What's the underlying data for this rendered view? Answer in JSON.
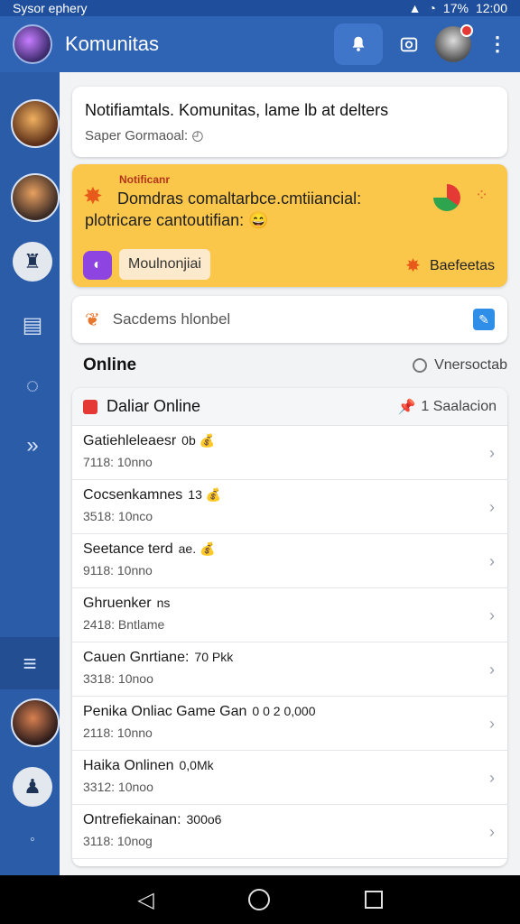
{
  "status_bar": {
    "carrier": "Sysor ephery",
    "time": "12:00",
    "battery": "17%"
  },
  "app_bar": {
    "title": "Komunitas"
  },
  "notification_card": {
    "title": "Notifiamtals. Komunitas, lame lb at delters",
    "subtitle": "Saper Gormaoal:"
  },
  "promo_card": {
    "tag": "Notificanr",
    "line1": "Domdras comaltarbce.cmtiiancial:",
    "line2": "plotricare cantoutifian: 😄",
    "chip_label": "Moulnonjiai",
    "action_label": "Baefeetas"
  },
  "search": {
    "placeholder": "Sacdems hlonbel"
  },
  "online_section": {
    "title": "Online",
    "right_label": "Vnersoctab"
  },
  "list": {
    "header_label": "Daliar Online",
    "header_right": "1 Saalacion",
    "rows": [
      {
        "name": "Gatiehleleaesr",
        "badge": "0b 💰",
        "sub": "7118: 10nno"
      },
      {
        "name": "Cocsenkamnes",
        "badge": "13 💰",
        "sub": "3518: 10nco"
      },
      {
        "name": "Seetance terd",
        "badge": "ae. 💰",
        "sub": "9118: 10nno"
      },
      {
        "name": "Ghruenker",
        "badge": "ns",
        "sub": "2418: Bntlame"
      },
      {
        "name": "Cauen Gnrtiane:",
        "badge": "70 Pkk",
        "sub": "3318: 10noo"
      },
      {
        "name": "Penika Onliac Game Gan",
        "badge": "0 0 2 0,000",
        "sub": "2118: 10nno"
      },
      {
        "name": "Haika Onlinen",
        "badge": "0,0Mk",
        "sub": "3312: 10noo"
      },
      {
        "name": "Ontrefiekainan:",
        "badge": "300o6",
        "sub": "3118: 10nog"
      }
    ]
  }
}
